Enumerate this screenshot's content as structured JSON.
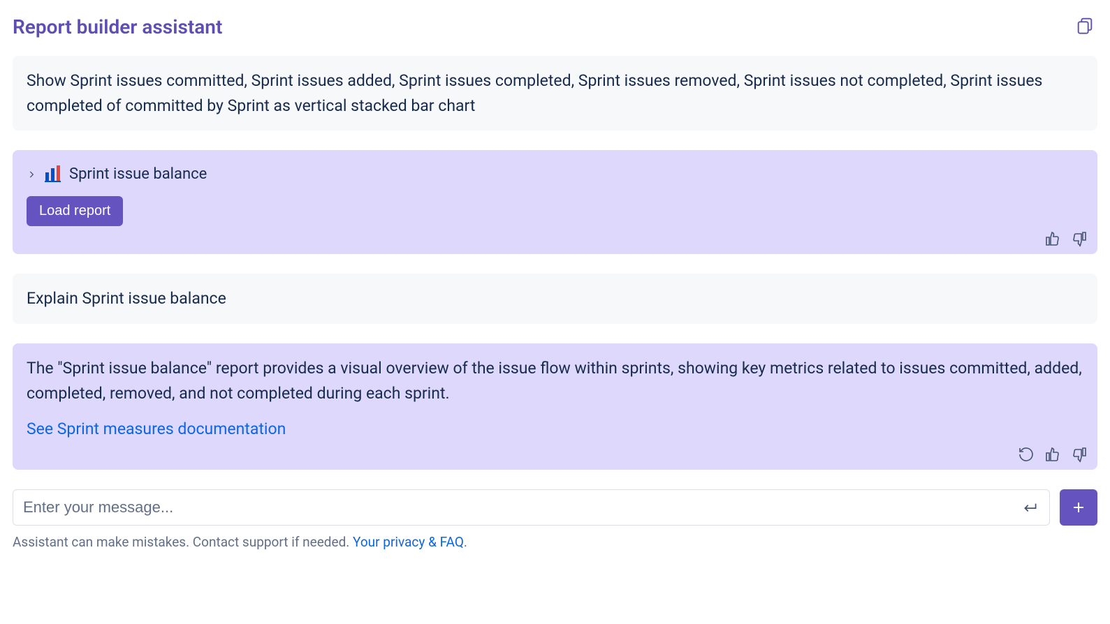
{
  "header": {
    "title": "Report builder assistant"
  },
  "messages": {
    "user1": "Show Sprint issues committed, Sprint issues added, Sprint issues completed, Sprint issues removed, Sprint issues not completed, Sprint issues completed of committed by Sprint as vertical stacked bar chart",
    "assistant1": {
      "report_title": "Sprint issue balance",
      "load_button": "Load report"
    },
    "user2": "Explain Sprint issue balance",
    "assistant2": {
      "text": "The \"Sprint issue balance\" report provides a visual overview of the issue flow within sprints, showing key metrics related to issues committed, added, completed, removed, and not completed during each sprint.",
      "link_text": "See Sprint measures documentation"
    }
  },
  "input": {
    "placeholder": "Enter your message..."
  },
  "footer": {
    "note_prefix": "Assistant can make mistakes. Contact support if needed. ",
    "link": "Your privacy & FAQ",
    "suffix": "."
  }
}
